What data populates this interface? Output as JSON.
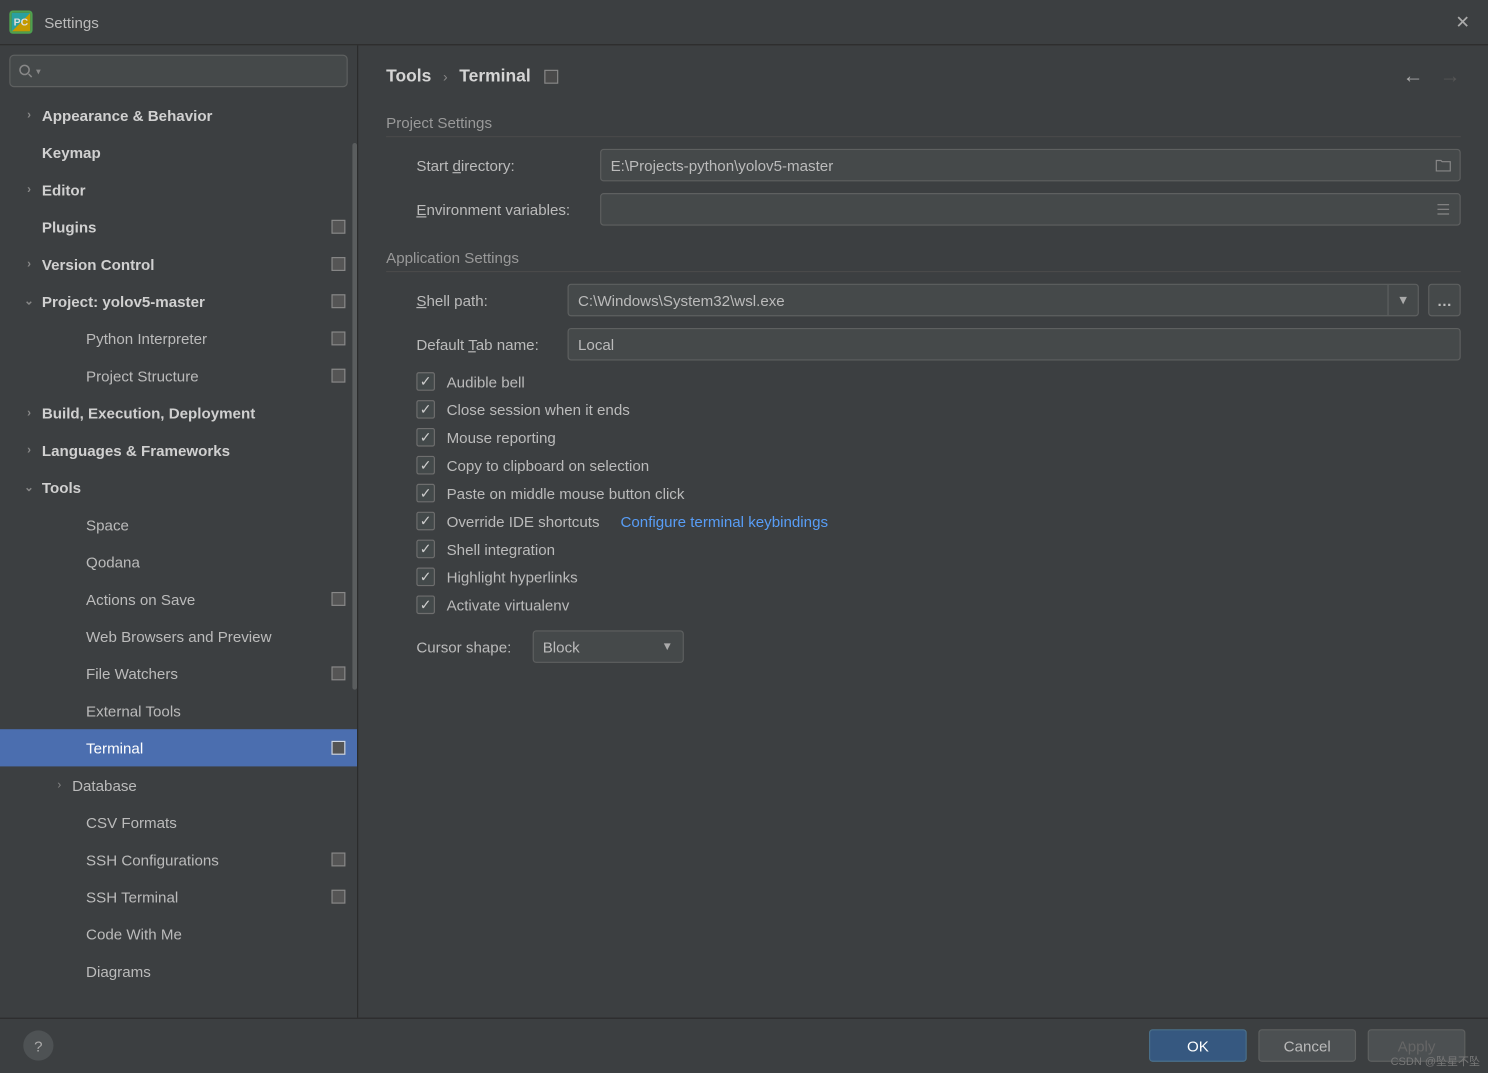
{
  "window": {
    "title": "Settings"
  },
  "search": {
    "placeholder": ""
  },
  "nav": [
    {
      "label": "Appearance & Behavior",
      "lvl": 0,
      "chev": "›",
      "tile": false
    },
    {
      "label": "Keymap",
      "lvl": 0,
      "chev": "",
      "tile": false,
      "nochev": true
    },
    {
      "label": "Editor",
      "lvl": 0,
      "chev": "›",
      "tile": false
    },
    {
      "label": "Plugins",
      "lvl": 0,
      "chev": "",
      "tile": true,
      "nochev": true
    },
    {
      "label": "Version Control",
      "lvl": 0,
      "chev": "›",
      "tile": true
    },
    {
      "label": "Project: yolov5-master",
      "lvl": 0,
      "chev": "⌄",
      "tile": true
    },
    {
      "label": "Python Interpreter",
      "lvl": 1,
      "tile": true,
      "nochev": true
    },
    {
      "label": "Project Structure",
      "lvl": 1,
      "tile": true,
      "nochev": true
    },
    {
      "label": "Build, Execution, Deployment",
      "lvl": 0,
      "chev": "›",
      "tile": false
    },
    {
      "label": "Languages & Frameworks",
      "lvl": 0,
      "chev": "›",
      "tile": false
    },
    {
      "label": "Tools",
      "lvl": 0,
      "chev": "⌄",
      "tile": false
    },
    {
      "label": "Space",
      "lvl": 1,
      "nochev": true
    },
    {
      "label": "Qodana",
      "lvl": 1,
      "nochev": true
    },
    {
      "label": "Actions on Save",
      "lvl": 1,
      "tile": true,
      "nochev": true
    },
    {
      "label": "Web Browsers and Preview",
      "lvl": 1,
      "nochev": true
    },
    {
      "label": "File Watchers",
      "lvl": 1,
      "tile": true,
      "nochev": true
    },
    {
      "label": "External Tools",
      "lvl": 1,
      "nochev": true
    },
    {
      "label": "Terminal",
      "lvl": 1,
      "tile": true,
      "selected": true,
      "nochev": true
    },
    {
      "label": "Database",
      "lvl": 2,
      "chev": "›"
    },
    {
      "label": "CSV Formats",
      "lvl": 1,
      "nochev": true
    },
    {
      "label": "SSH Configurations",
      "lvl": 1,
      "tile": true,
      "nochev": true
    },
    {
      "label": "SSH Terminal",
      "lvl": 1,
      "tile": true,
      "nochev": true
    },
    {
      "label": "Code With Me",
      "lvl": 1,
      "nochev": true
    },
    {
      "label": "Diagrams",
      "lvl": 1,
      "nochev": true
    }
  ],
  "crumb": {
    "a": "Tools",
    "b": "Terminal"
  },
  "sections": {
    "project": "Project Settings",
    "app": "Application Settings"
  },
  "labels": {
    "start_dir_pre": "Start ",
    "start_dir_u": "d",
    "start_dir_post": "irectory:",
    "env_pre": "",
    "env_u": "E",
    "env_post": "nvironment variables:",
    "shell_pre": "",
    "shell_u": "S",
    "shell_post": "hell path:",
    "tab_pre": "Default ",
    "tab_u": "T",
    "tab_post": "ab name:",
    "cursor": "Cursor shape:"
  },
  "values": {
    "start_dir": "E:\\Projects-python\\yolov5-master",
    "env": "",
    "shell": "C:\\Windows\\System32\\wsl.exe",
    "tab": "Local",
    "cursor": "Block"
  },
  "checks": [
    {
      "label": "Audible bell",
      "checked": true
    },
    {
      "label": "Close session when it ends",
      "checked": true
    },
    {
      "label": "Mouse reporting",
      "checked": true
    },
    {
      "label": "Copy to clipboard on selection",
      "checked": true
    },
    {
      "label": "Paste on middle mouse button click",
      "checked": true
    },
    {
      "label": "Override IDE shortcuts",
      "checked": true,
      "link": "Configure terminal keybindings"
    },
    {
      "label": "Shell integration",
      "checked": true
    },
    {
      "label": "Highlight hyperlinks",
      "checked": true
    },
    {
      "label": "Activate virtualenv",
      "checked": true
    }
  ],
  "footer": {
    "ok": "OK",
    "cancel": "Cancel",
    "apply": "Apply"
  },
  "watermark": "CSDN @坠星不坠"
}
